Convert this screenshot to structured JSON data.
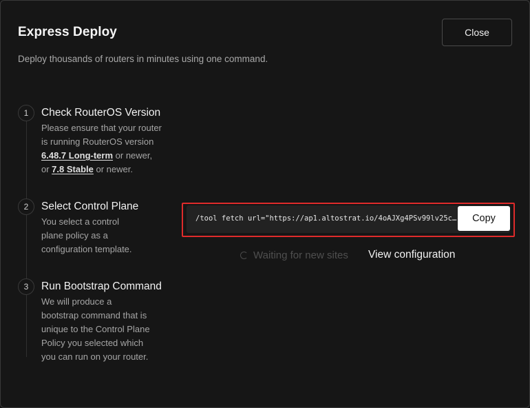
{
  "modal": {
    "title": "Express Deploy",
    "subtitle": "Deploy thousands of routers in minutes using one command.",
    "close_label": "Close"
  },
  "steps": [
    {
      "number": "1",
      "title": "Check RouterOS Version",
      "desc_line1": "Please ensure that your router",
      "desc_line2": "is running RouterOS version",
      "link1": "6.48.7 Long-term",
      "after_link1": " or newer,",
      "before_link2": "or ",
      "link2": "7.8 Stable",
      "after_link2": " or newer."
    },
    {
      "number": "2",
      "title": "Select Control Plane",
      "desc_lines": [
        "You select a control",
        "plane policy as a",
        "configuration template."
      ]
    },
    {
      "number": "3",
      "title": "Run Bootstrap Command",
      "desc_lines": [
        "We will produce a",
        "bootstrap command that is",
        "unique to the Control Plane",
        "Policy you selected which",
        "you can run on your router."
      ]
    }
  ],
  "command": {
    "text": "/tool fetch url=\"https://ap1.altostrat.io/4oAJXg4PSv99lv25cdt5…",
    "copy_label": "Copy"
  },
  "status": {
    "waiting_text": "Waiting for new sites",
    "view_config_label": "View configuration"
  },
  "icons": {
    "spinner": "loading-spinner-icon"
  },
  "colors": {
    "background": "#161616",
    "highlight_border": "#e02b2b",
    "copy_button_bg": "#ffffff"
  }
}
